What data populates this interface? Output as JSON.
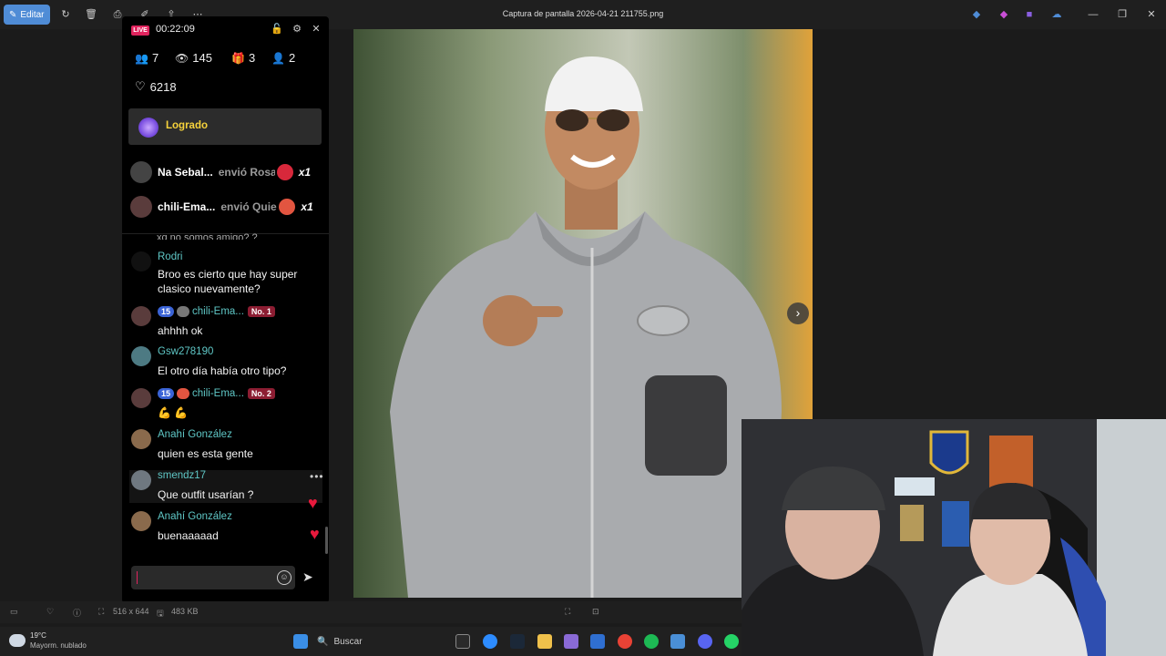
{
  "app": {
    "edit_label": "Editar",
    "window_title": "Captura de pantalla 2026-04-21 211755.png",
    "image_dimensions": "516 x 644",
    "file_size": "483 KB"
  },
  "live": {
    "badge": "LIVE",
    "timer": "00:22:09",
    "stats": {
      "viewers_joined": "7",
      "views": "145",
      "gifts": "3",
      "followers": "2",
      "likes": "6218"
    },
    "goal_label": "Logrado",
    "gifts": [
      {
        "user": "Na Sebal...",
        "action": "envió Rosa",
        "count": "x1",
        "color": "#d8283b"
      },
      {
        "user": "chili-Ema...",
        "action": "envió Quiero",
        "count": "x1",
        "color": "#e25540"
      }
    ],
    "cut_text": "xq no somos amigo? ?",
    "messages": [
      {
        "user": "Rodri",
        "text": "Broo es cierto que hay super clasico nuevamente?"
      },
      {
        "user": "chili-Ema...",
        "level": "15",
        "rank": "No. 1",
        "text": "ahhhh ok"
      },
      {
        "user": "Gsw278190",
        "text": "El otro día había otro tipo?"
      },
      {
        "user": "chili-Ema...",
        "level": "15",
        "rank": "No. 2",
        "text": "💪 💪"
      },
      {
        "user": "Anahí González",
        "text": "quien es esta gente"
      },
      {
        "user": "smendz17",
        "text": "Que outfit usarían ?",
        "more": "•••"
      },
      {
        "user": "Anahí González",
        "text": "buenaaaaad"
      }
    ]
  },
  "taskbar": {
    "temperature": "19°C",
    "weather": "Mayorm. nublado",
    "search_placeholder": "Buscar"
  },
  "icons": {
    "people": "people-icon",
    "eye": "eye-icon",
    "gift": "gift-icon",
    "person_add": "person-add-icon",
    "heart": "heart-icon"
  },
  "colors": {
    "accent": "#4f8cd6",
    "live_red": "#e0245e",
    "username_teal": "#5fc7c6",
    "goal_yellow": "#f7d33b"
  }
}
